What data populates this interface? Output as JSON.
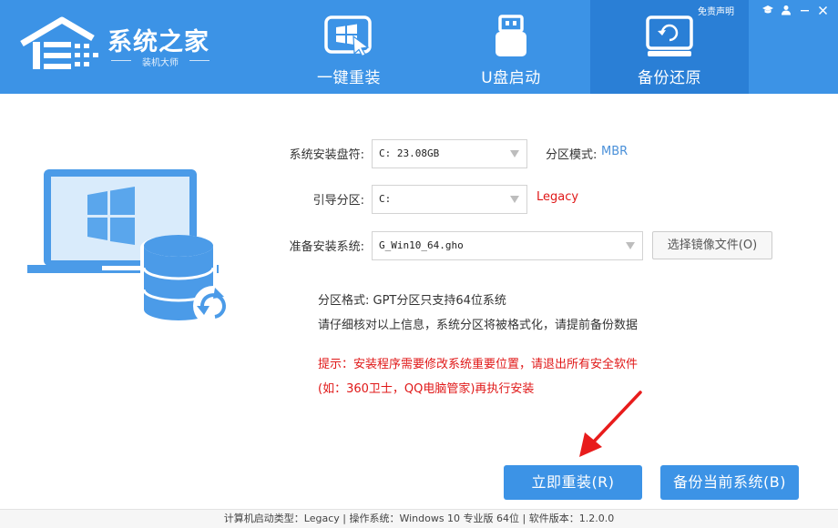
{
  "app": {
    "title": "系统之家",
    "subtitle": "装机大师"
  },
  "top_links": {
    "disclaimer": "免责声明",
    "icons": [
      "graduation-cap-icon",
      "user-icon",
      "minimize-icon",
      "close-icon"
    ]
  },
  "nav": [
    {
      "label": "一键重装",
      "icon": "windows-cursor-icon",
      "active": false
    },
    {
      "label": "U盘启动",
      "icon": "usb-drive-icon",
      "active": false
    },
    {
      "label": "备份还原",
      "icon": "monitor-restore-icon",
      "active": true
    }
  ],
  "form": {
    "install_disk_label": "系统安装盘符:",
    "install_disk_value": "C: 23.08GB",
    "partition_mode_label": "分区模式:",
    "partition_mode_value": "MBR",
    "boot_partition_label": "引导分区:",
    "boot_partition_value": "C:",
    "boot_type": "Legacy",
    "system_label": "准备安装系统:",
    "system_value": "G_Win10_64.gho",
    "browse_button": "选择镜像文件(O)"
  },
  "notes": {
    "format_line": "分区格式:  GPT分区只支持64位系统",
    "check_line": "请仔细核对以上信息，系统分区将被格式化，请提前备份数据",
    "warning_line1": "提示：安装程序需要修改系统重要位置，请退出所有安全软件",
    "warning_line2": "(如：360卫士，QQ电脑管家)再执行安装"
  },
  "actions": {
    "install": "立即重装(R)",
    "backup": "备份当前系统(B)"
  },
  "status_bar": {
    "text": "计算机启动类型：Legacy | 操作系统：Windows 10 专业版 64位 | 软件版本：1.2.0.0"
  },
  "colors": {
    "header": "#3c93e6",
    "active_tab": "#2a7fd6",
    "button": "#3c93e6",
    "warning": "#e01818",
    "value_blue": "#4a90d9",
    "arrow": "#e81c1c"
  }
}
